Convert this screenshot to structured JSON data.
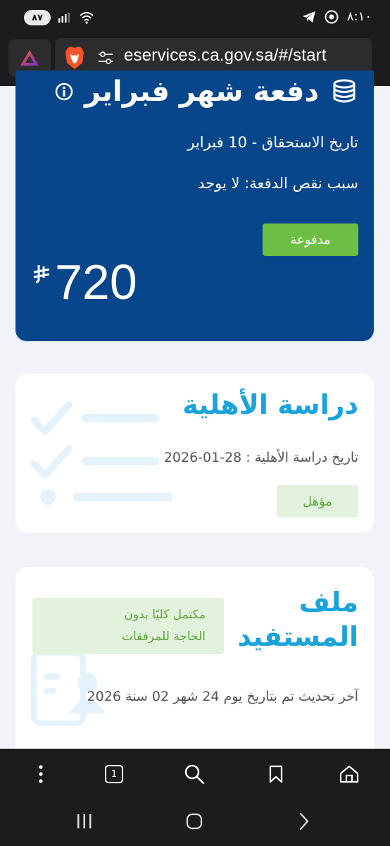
{
  "status_bar": {
    "battery_percent": "٨٧",
    "time": "٨:١٠"
  },
  "browser": {
    "url": "eservices.ca.gov.sa/#/start",
    "tab_count": "1"
  },
  "payment_card": {
    "title": "دفعة شهر فبراير",
    "due_date": "تاريخ الاستحقاق - 10 فبراير",
    "shortfall_reason": "سبب نقص الدفعة: لا يوجد",
    "status": "مدفوعة",
    "amount": "720",
    "currency_symbol": "⃁",
    "colors": {
      "card": "#08468b",
      "status_bg": "#6cbf42"
    }
  },
  "eligibility_card": {
    "title": "دراسة الأهلية",
    "study_date": "تاريخ دراسة الأهلية : 28-01-2026",
    "status": "مؤهل",
    "colors": {
      "title": "#1aa3dc",
      "status_bg": "#e3f2dd",
      "status_text": "#5aa83a"
    }
  },
  "beneficiary_card": {
    "title_line1": "ملف",
    "title_line2": "المستفيد",
    "completion_line1": "مكتمل كليًا بدون",
    "completion_line2": "الحاجة للمرفقات",
    "last_update": "آخر تحديث تم بتاريخ يوم 24 شهر 02 سنة 2026"
  }
}
